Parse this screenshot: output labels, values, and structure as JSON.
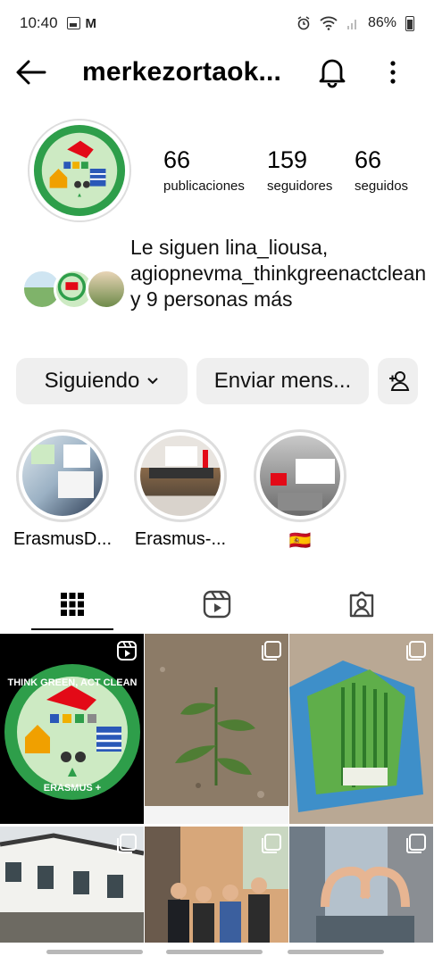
{
  "status_bar": {
    "time": "10:40",
    "battery": "86%"
  },
  "header": {
    "username": "merkezortaok...",
    "icons": [
      "back-arrow-icon",
      "bell-icon",
      "more-vertical-icon"
    ]
  },
  "profile": {
    "avatar_text_top": "THINK GREEN, ACT CLEAN",
    "avatar_text_bottom": "ERASMUS +",
    "stats": [
      {
        "value": "66",
        "label": "publicaciones"
      },
      {
        "value": "159",
        "label": "seguidores"
      },
      {
        "value": "66",
        "label": "seguidos"
      }
    ],
    "followed_by": "Le siguen lina_liousa, agiopnevma_thinkgreenactclean y 9 personas más"
  },
  "actions": {
    "following_label": "Siguiendo",
    "message_label": "Enviar mens...",
    "add_user_icon": "add-person-icon"
  },
  "highlights": [
    {
      "label": "ErasmusD..."
    },
    {
      "label": "Erasmus-..."
    },
    {
      "label": "🇪🇸"
    }
  ],
  "tabs": [
    {
      "name": "grid",
      "icon": "grid-icon",
      "active": true
    },
    {
      "name": "reels",
      "icon": "reels-icon",
      "active": false
    },
    {
      "name": "tagged",
      "icon": "tagged-person-icon",
      "active": false
    }
  ],
  "colors": {
    "button_bg": "#efefef",
    "logo_green": "#2e9e4a",
    "logo_bg": "#cdeac3",
    "flag_red": "#e30a17"
  }
}
